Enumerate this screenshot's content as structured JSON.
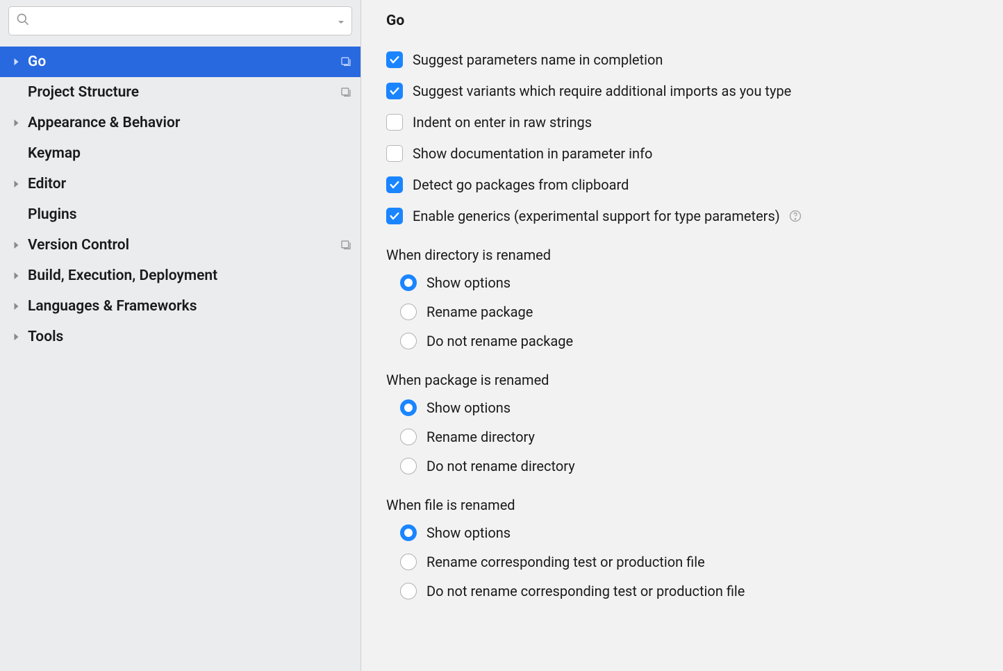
{
  "search": {
    "placeholder": ""
  },
  "sidebar": {
    "items": [
      {
        "label": "Go",
        "expandable": true,
        "selected": true,
        "scopeIcon": true
      },
      {
        "label": "Project Structure",
        "expandable": false,
        "selected": false,
        "scopeIcon": true
      },
      {
        "label": "Appearance & Behavior",
        "expandable": true,
        "selected": false,
        "scopeIcon": false
      },
      {
        "label": "Keymap",
        "expandable": false,
        "selected": false,
        "scopeIcon": false
      },
      {
        "label": "Editor",
        "expandable": true,
        "selected": false,
        "scopeIcon": false
      },
      {
        "label": "Plugins",
        "expandable": false,
        "selected": false,
        "scopeIcon": false
      },
      {
        "label": "Version Control",
        "expandable": true,
        "selected": false,
        "scopeIcon": true
      },
      {
        "label": "Build, Execution, Deployment",
        "expandable": true,
        "selected": false,
        "scopeIcon": false
      },
      {
        "label": "Languages & Frameworks",
        "expandable": true,
        "selected": false,
        "scopeIcon": false
      },
      {
        "label": "Tools",
        "expandable": true,
        "selected": false,
        "scopeIcon": false
      }
    ]
  },
  "main": {
    "title": "Go",
    "checkboxes": [
      {
        "label": "Suggest parameters name in completion",
        "checked": true,
        "help": false
      },
      {
        "label": "Suggest variants which require additional imports as you type",
        "checked": true,
        "help": false
      },
      {
        "label": "Indent on enter in raw strings",
        "checked": false,
        "help": false
      },
      {
        "label": "Show documentation in parameter info",
        "checked": false,
        "help": false
      },
      {
        "label": "Detect go packages from clipboard",
        "checked": true,
        "help": false
      },
      {
        "label": "Enable generics (experimental support for type parameters)",
        "checked": true,
        "help": true
      }
    ],
    "groups": [
      {
        "title": "When directory is renamed",
        "options": [
          {
            "label": "Show options",
            "checked": true
          },
          {
            "label": "Rename package",
            "checked": false
          },
          {
            "label": "Do not rename package",
            "checked": false
          }
        ]
      },
      {
        "title": "When package is renamed",
        "options": [
          {
            "label": "Show options",
            "checked": true
          },
          {
            "label": "Rename directory",
            "checked": false
          },
          {
            "label": "Do not rename directory",
            "checked": false
          }
        ]
      },
      {
        "title": "When file is renamed",
        "options": [
          {
            "label": "Show options",
            "checked": true
          },
          {
            "label": "Rename corresponding test or production file",
            "checked": false
          },
          {
            "label": "Do not rename corresponding test or production file",
            "checked": false
          }
        ]
      }
    ]
  }
}
